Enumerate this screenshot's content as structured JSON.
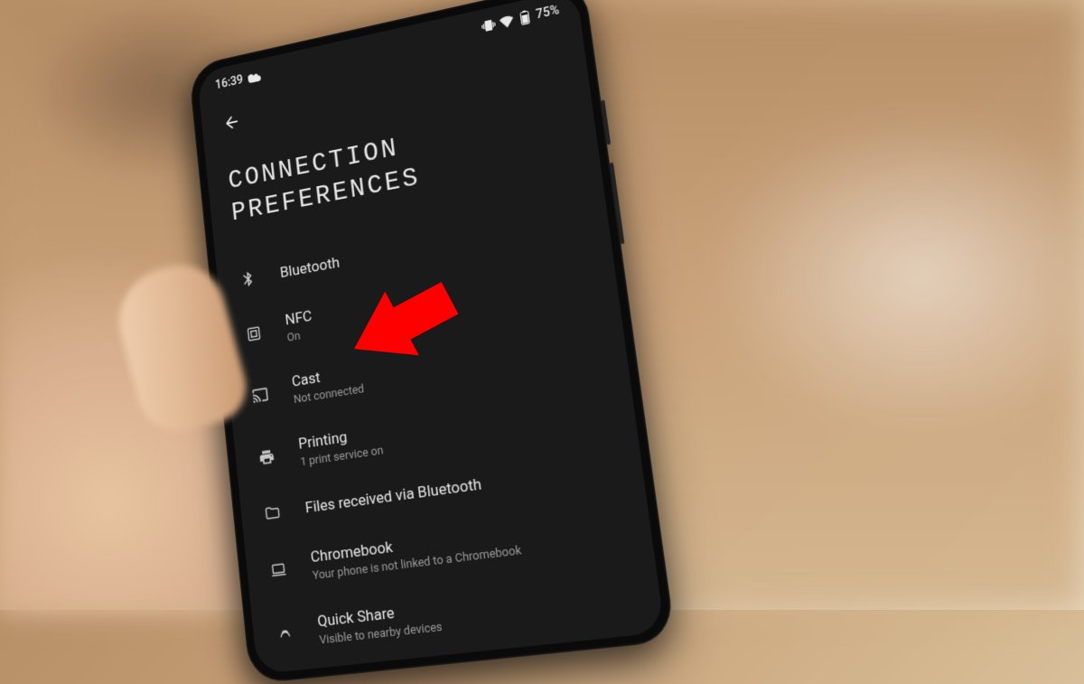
{
  "status": {
    "time": "16:39",
    "battery": "75%"
  },
  "page": {
    "title_line1": "CONNECTION",
    "title_line2": "PREFERENCES"
  },
  "items": [
    {
      "icon": "bluetooth",
      "label": "Bluetooth",
      "sub": ""
    },
    {
      "icon": "nfc",
      "label": "NFC",
      "sub": "On"
    },
    {
      "icon": "cast",
      "label": "Cast",
      "sub": "Not connected"
    },
    {
      "icon": "print",
      "label": "Printing",
      "sub": "1 print service on"
    },
    {
      "icon": "folder",
      "label": "Files received via Bluetooth",
      "sub": ""
    },
    {
      "icon": "laptop",
      "label": "Chromebook",
      "sub": "Your phone is not linked to a Chromebook"
    },
    {
      "icon": "share",
      "label": "Quick Share",
      "sub": "Visible to nearby devices"
    }
  ],
  "annotation": {
    "arrow_color": "#ff0000"
  }
}
